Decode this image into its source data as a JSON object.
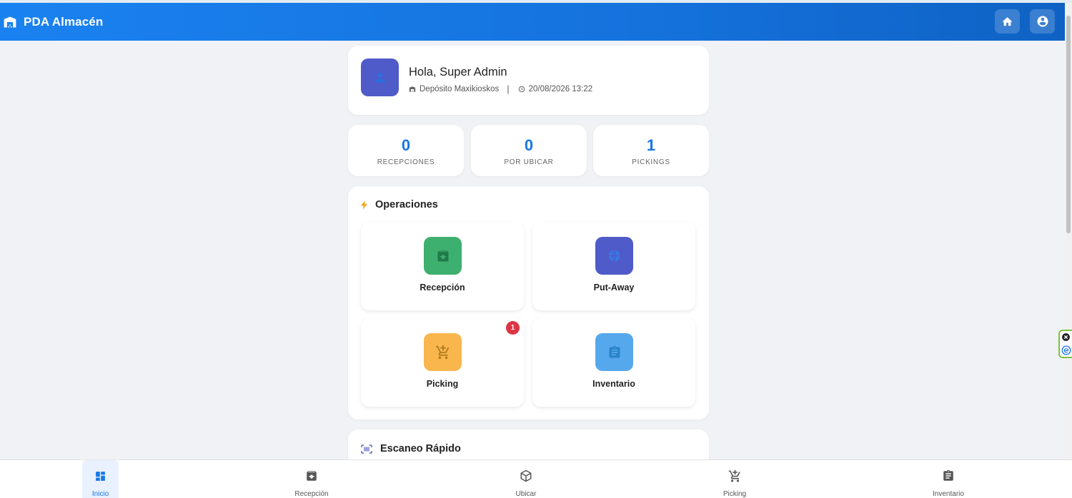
{
  "header": {
    "title": "PDA Almacén",
    "home_icon": "home-icon",
    "account_icon": "account-circle-icon"
  },
  "welcome": {
    "greeting": "Hola, Super Admin",
    "warehouse": "Depósito Maxikioskos",
    "datetime": "20/08/2026 13:22"
  },
  "stats": [
    {
      "value": "0",
      "label": "RECEPCIONES"
    },
    {
      "value": "0",
      "label": "POR UBICAR"
    },
    {
      "value": "1",
      "label": "PICKINGS"
    }
  ],
  "operations": {
    "title": "Operaciones",
    "tiles": [
      {
        "label": "Recepción",
        "icon": "archive-icon",
        "color": "#3daf6e"
      },
      {
        "label": "Put-Away",
        "icon": "globe-icon",
        "color": "#4f5bc8"
      },
      {
        "label": "Picking",
        "icon": "cart-icon",
        "color": "#f9b64c",
        "badge": "1"
      },
      {
        "label": "Inventario",
        "icon": "clipboard-icon",
        "color": "#3d9be9"
      }
    ]
  },
  "quick_scan": {
    "title": "Escaneo Rápido"
  },
  "nav": [
    {
      "label": "Inicio",
      "icon": "dashboard-icon"
    },
    {
      "label": "Recepción",
      "icon": "archive-icon"
    },
    {
      "label": "Ubicar",
      "icon": "box-icon"
    },
    {
      "label": "Picking",
      "icon": "cart-icon"
    },
    {
      "label": "Inventario",
      "icon": "clipboard-icon"
    }
  ],
  "colors": {
    "primary": "#1677e6",
    "badge": "#dc3545"
  }
}
